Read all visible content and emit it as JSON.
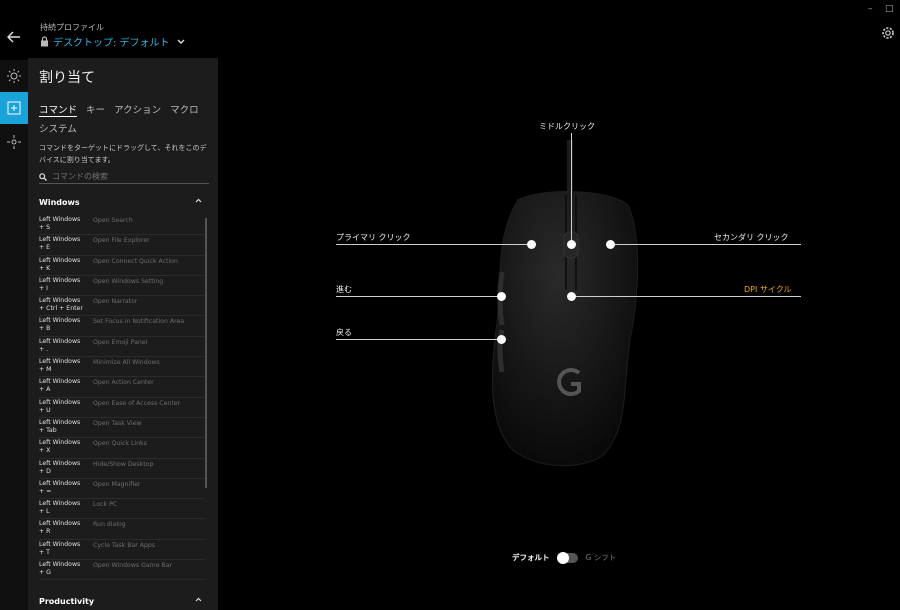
{
  "header": {
    "profile_label": "持続プロファイル",
    "profile_name": "デスクトップ: デフォルト",
    "minimize": "–",
    "maximize": "□"
  },
  "panel": {
    "title": "割り当て",
    "tabs": [
      "コマンド",
      "キー",
      "アクション",
      "マクロ",
      "システム"
    ],
    "description": "コマンドをターゲットにドラッグして、それをこのデバイスに割り当てます。",
    "search_placeholder": "コマンドの検索",
    "section_windows": "Windows",
    "section_productivity": "Productivity",
    "commands": [
      {
        "key": "Left Windows\n+ S",
        "action": "Open Search"
      },
      {
        "key": "Left Windows\n+ E",
        "action": "Open File Explorer"
      },
      {
        "key": "Left Windows\n+ K",
        "action": "Open Connect Quick Action"
      },
      {
        "key": "Left Windows\n+ I",
        "action": "Open Windows Setting"
      },
      {
        "key": "Left Windows\n+ Ctrl + Enter",
        "action": "Open Narrator"
      },
      {
        "key": "Left Windows\n+ B",
        "action": "Set Focus in Notification Area"
      },
      {
        "key": "Left Windows\n+ .",
        "action": "Open Emoji Panel"
      },
      {
        "key": "Left Windows\n+ M",
        "action": "Minimize All Windows"
      },
      {
        "key": "Left Windows\n+ A",
        "action": "Open Action Center"
      },
      {
        "key": "Left Windows\n+ U",
        "action": "Open Ease of Access Center"
      },
      {
        "key": "Left Windows\n+ Tab",
        "action": "Open Task View"
      },
      {
        "key": "Left Windows\n+ X",
        "action": "Open Quick Links"
      },
      {
        "key": "Left Windows\n+ D",
        "action": "Hide/Show Desktop"
      },
      {
        "key": "Left Windows\n+ =",
        "action": "Open Magnifier"
      },
      {
        "key": "Left Windows\n+ L",
        "action": "Lock PC"
      },
      {
        "key": "Left Windows\n+ R",
        "action": "Run dialog"
      },
      {
        "key": "Left Windows\n+ T",
        "action": "Cycle Task Bar Apps"
      },
      {
        "key": "Left Windows\n+ G",
        "action": "Open Windows Game Bar"
      }
    ]
  },
  "mouse": {
    "middle_click": "ミドルクリック",
    "primary_click": "プライマリ クリック",
    "secondary_click": "セカンダリ クリック",
    "forward": "進む",
    "dpi_cycle": "DPI サイクル",
    "back": "戻る",
    "accent": "#f1a51a"
  },
  "footer": {
    "default_label": "デフォルト",
    "gshift_label": "G シフト"
  }
}
